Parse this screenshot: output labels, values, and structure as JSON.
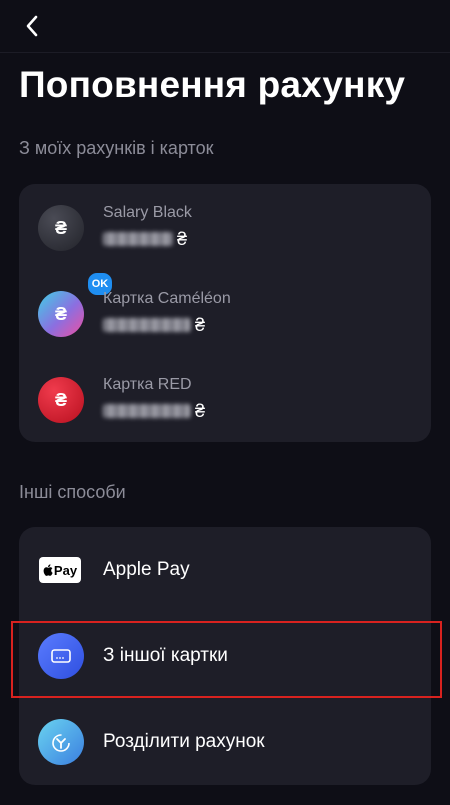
{
  "header": {
    "back_icon": "chevron-left-icon"
  },
  "page_title": "Поповнення рахунку",
  "own_section": {
    "label": "З моїх  рахунків і карток",
    "accounts": [
      {
        "name": "Salary Black",
        "currency": "₴",
        "icon_symbol": "₴",
        "icon_color": "#2f3037",
        "badge": ""
      },
      {
        "name": "Картка Caméléon",
        "currency": "₴",
        "icon_symbol": "₴",
        "icon_color": "#7b7fd8",
        "badge": "OK"
      },
      {
        "name": "Картка RED",
        "currency": "₴",
        "icon_symbol": "₴",
        "icon_color": "#d6172d",
        "badge": ""
      }
    ]
  },
  "other_section": {
    "label": "Інші способи",
    "methods": [
      {
        "label": "Apple Pay",
        "icon": "apple-pay-icon",
        "icon_text": "Pay"
      },
      {
        "label": "З іншої картки",
        "icon": "card-icon"
      },
      {
        "label": "Розділити рахунок",
        "icon": "split-bill-icon"
      }
    ]
  },
  "colors": {
    "background": "#0e0e16",
    "card": "#1e1e28",
    "muted_text": "#8c8c98",
    "highlight": "#d8221f",
    "accent_blue": "#3d63f0"
  }
}
